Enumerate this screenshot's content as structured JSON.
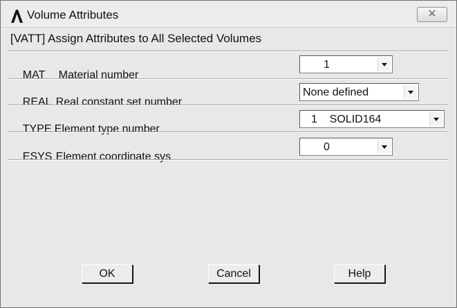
{
  "window": {
    "title": "Volume Attributes",
    "close_glyph": "✕"
  },
  "command": {
    "text": "[VATT]  Assign Attributes to All Selected Volumes"
  },
  "rows": [
    {
      "key": "MAT",
      "label": "Material number",
      "value": "1"
    },
    {
      "key": "REAL",
      "label": "Real constant set number",
      "value": "None defined"
    },
    {
      "key": "TYPE",
      "label": "Element type number",
      "value": "1    SOLID164"
    },
    {
      "key": "ESYS",
      "label": "Element coordinate sys",
      "value": "0"
    }
  ],
  "buttons": {
    "ok": "OK",
    "cancel": "Cancel",
    "help": "Help"
  },
  "icons": {
    "app": "ansys-logo-icon",
    "close": "close-icon",
    "dropdown": "chevron-down-icon"
  }
}
